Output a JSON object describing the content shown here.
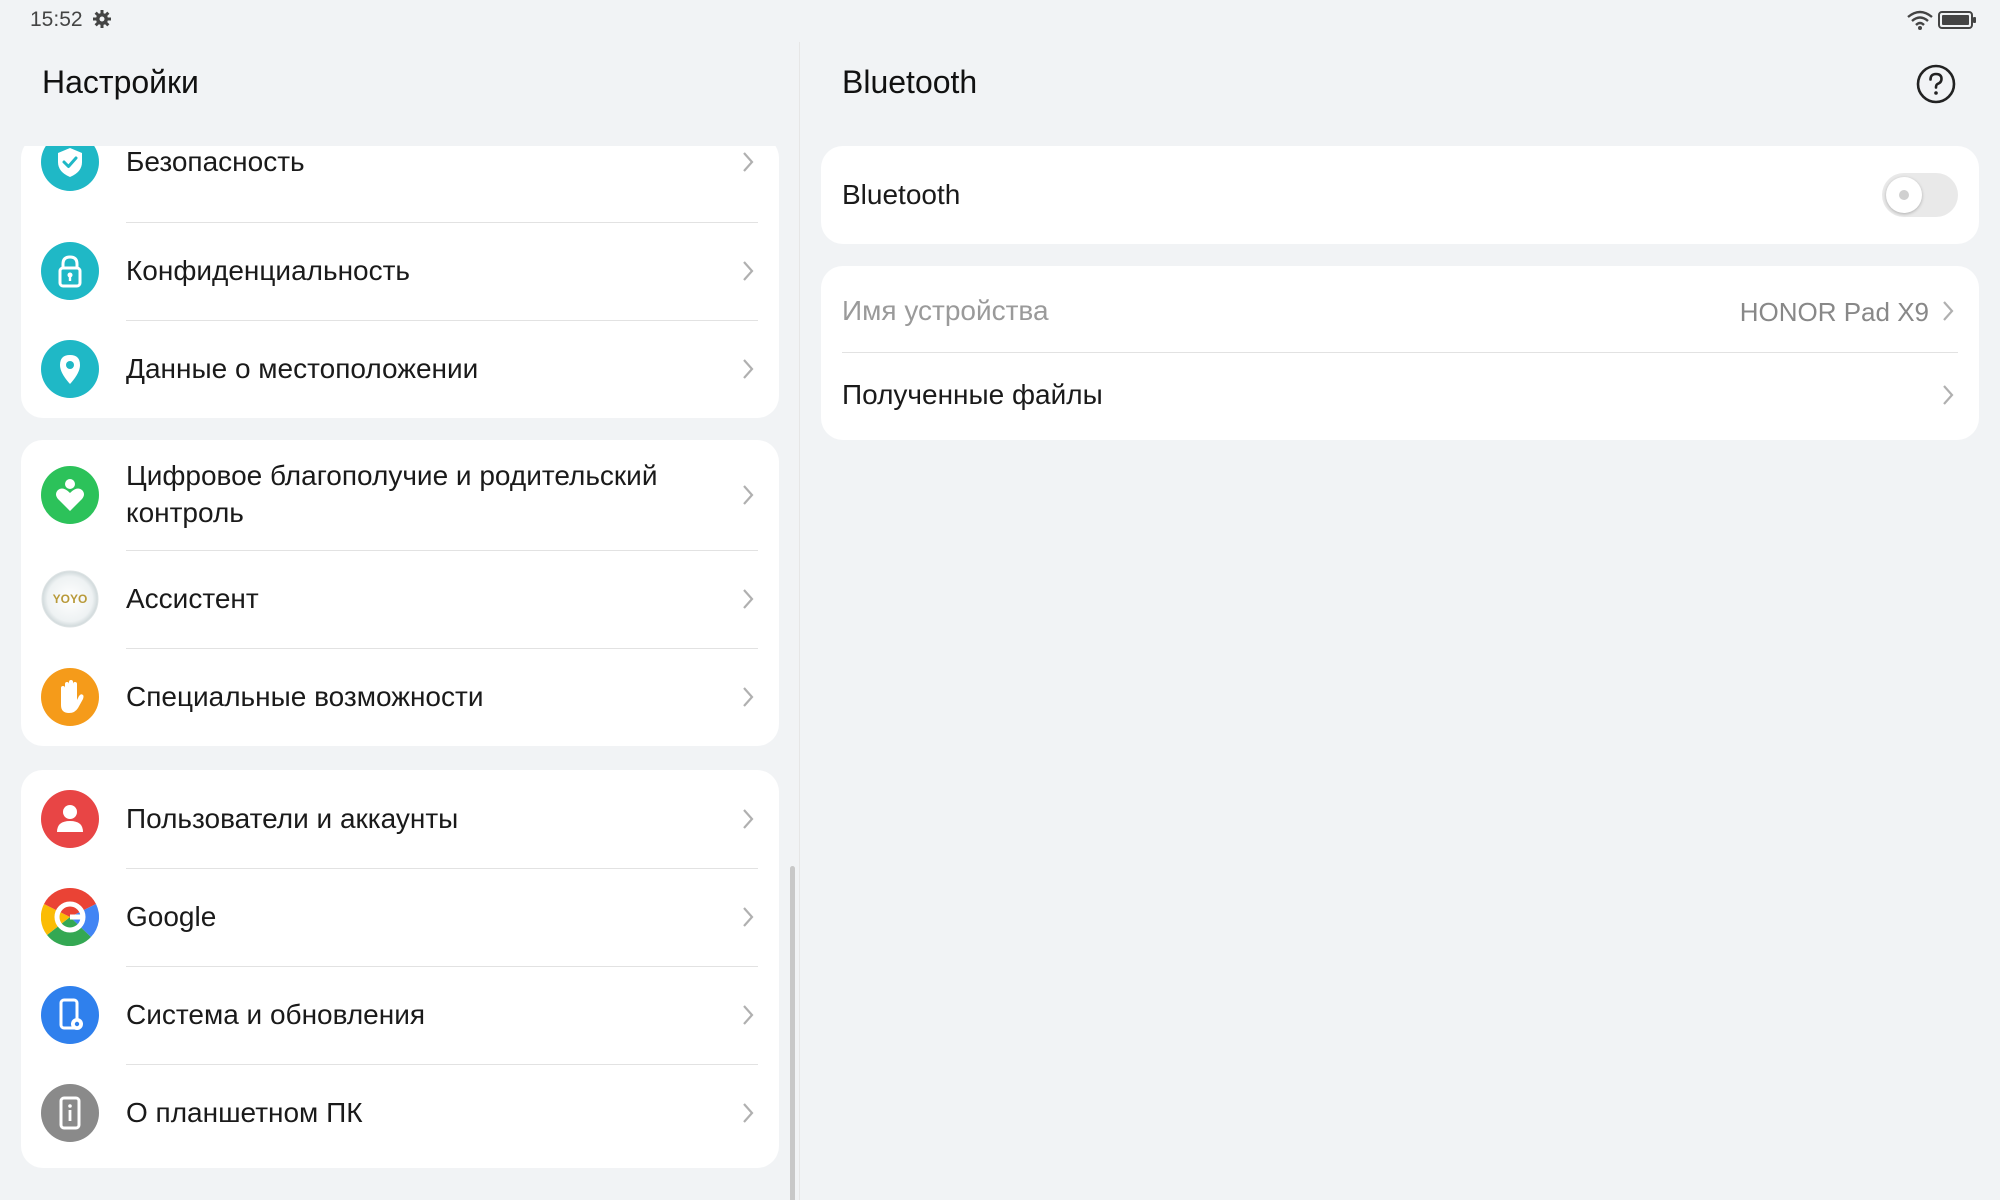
{
  "status_bar": {
    "time": "15:52"
  },
  "left": {
    "title": "Настройки",
    "groups": [
      {
        "items": [
          {
            "label": "Безопасность",
            "icon": "shield-icon",
            "color": "#1fb8c6"
          },
          {
            "label": "Конфиденциальность",
            "icon": "privacy-lock-icon",
            "color": "#1fb8c6"
          },
          {
            "label": "Данные о местоположении",
            "icon": "location-pin-icon",
            "color": "#1fb8c6"
          }
        ]
      },
      {
        "items": [
          {
            "label": "Цифровое благополучие и родительский",
            "label2": "контроль",
            "icon": "digital-wellbeing-icon",
            "color": "#2cc25a"
          },
          {
            "label": "Ассистент",
            "icon": "yoyo-assistant-icon",
            "icon_text": "YOYO",
            "color": "#f3f3f3"
          },
          {
            "label": "Специальные возможности",
            "icon": "hand-icon",
            "color": "#f59b1a"
          }
        ]
      },
      {
        "items": [
          {
            "label": "Пользователи и аккаунты",
            "icon": "user-icon",
            "color": "#e84545"
          },
          {
            "label": "Google",
            "icon": "google-icon",
            "color": "#ffffff"
          },
          {
            "label": "Система и обновления",
            "icon": "system-update-icon",
            "color": "#2f80ed"
          },
          {
            "label": "О планшетном ПК",
            "icon": "about-tablet-icon",
            "color": "#8a8a8a"
          }
        ]
      }
    ]
  },
  "right": {
    "title": "Bluetooth",
    "toggle_card": {
      "label": "Bluetooth",
      "enabled": false
    },
    "device_name": {
      "label": "Имя устройства",
      "value": "HONOR Pad X9"
    },
    "received_files": {
      "label": "Полученные файлы"
    }
  }
}
